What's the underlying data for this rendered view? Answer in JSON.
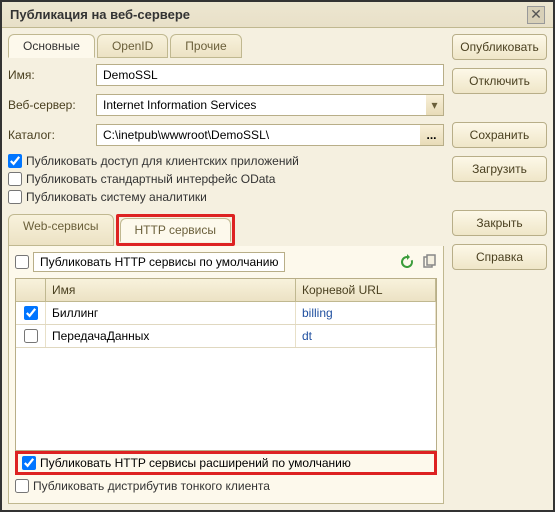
{
  "window": {
    "title": "Публикация на веб-сервере"
  },
  "tabs": {
    "main": "Основные",
    "openid": "OpenID",
    "other": "Прочие"
  },
  "form": {
    "name_label": "Имя:",
    "name_value": "DemoSSL",
    "server_label": "Веб-сервер:",
    "server_value": "Internet Information Services",
    "catalog_label": "Каталог:",
    "catalog_value": "C:\\inetpub\\wwwroot\\DemoSSL\\",
    "catalog_btn": "..."
  },
  "checks": {
    "client_access": "Публиковать доступ для клиентских приложений",
    "odata": "Публиковать стандартный интерфейс OData",
    "analytics": "Публиковать систему аналитики"
  },
  "inner_tabs": {
    "ws": "Web-сервисы",
    "http": "HTTP сервисы"
  },
  "sub": {
    "default_label": "Публиковать HTTP сервисы по умолчанию",
    "col_name": "Имя",
    "col_url": "Корневой URL"
  },
  "rows": [
    {
      "checked": true,
      "name": "Биллинг",
      "url": "billing"
    },
    {
      "checked": false,
      "name": "ПередачаДанных",
      "url": "dt"
    }
  ],
  "bottom": {
    "ext_default": "Публиковать HTTP сервисы расширений по умолчанию",
    "thin_client": "Публиковать дистрибутив тонкого клиента"
  },
  "actions": {
    "publish": "Опубликовать",
    "disconnect": "Отключить",
    "save": "Сохранить",
    "load": "Загрузить",
    "close": "Закрыть",
    "help": "Справка"
  }
}
